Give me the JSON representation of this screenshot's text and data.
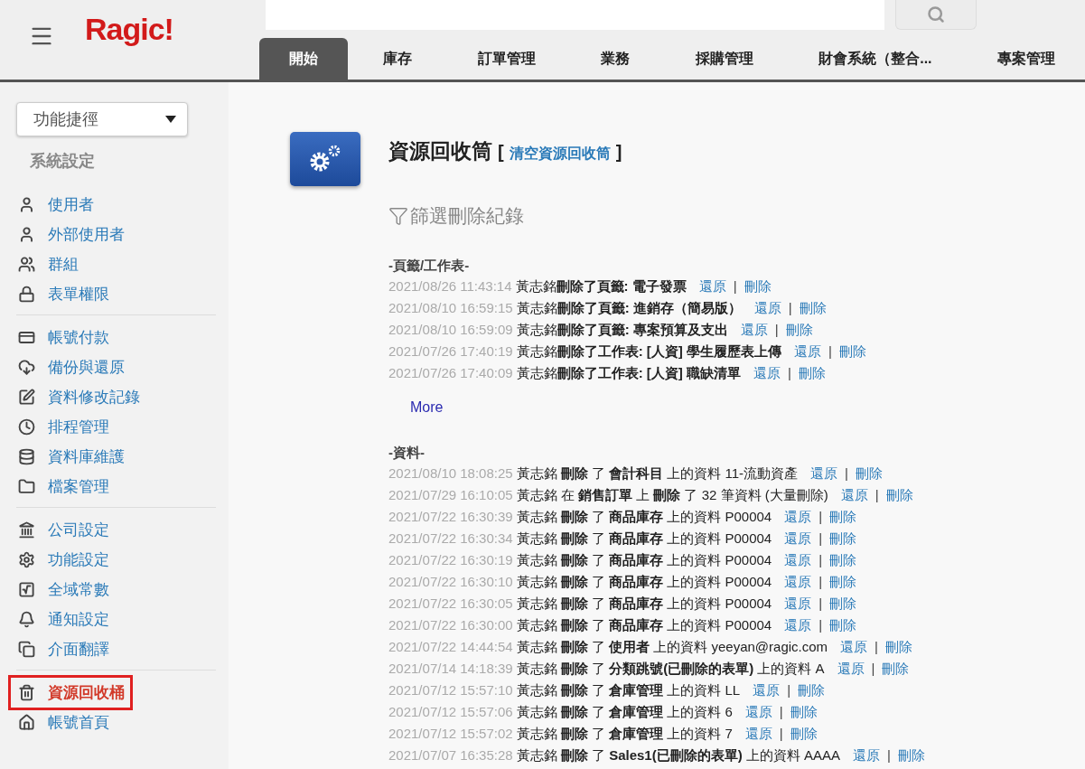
{
  "header": {
    "logo": "Ragic!",
    "tabs": [
      {
        "label": "開始",
        "selected": true
      },
      {
        "label": "庫存",
        "selected": false
      },
      {
        "label": "訂單管理",
        "selected": false
      },
      {
        "label": "業務",
        "selected": false
      },
      {
        "label": "採購管理",
        "selected": false
      },
      {
        "label": "財會系統（整合...",
        "selected": false
      },
      {
        "label": "專案管理",
        "selected": false
      }
    ]
  },
  "sidebar": {
    "shortcut": "功能捷徑",
    "section_title": "系統設定",
    "groups": [
      [
        {
          "kind": "user",
          "label": "使用者",
          "selected": false
        },
        {
          "kind": "user",
          "label": "外部使用者",
          "selected": false
        },
        {
          "kind": "group",
          "label": "群組",
          "selected": false
        },
        {
          "kind": "lock",
          "label": "表單權限",
          "selected": false
        }
      ],
      [
        {
          "kind": "card",
          "label": "帳號付款",
          "selected": false
        },
        {
          "kind": "cloud",
          "label": "備份與還原",
          "selected": false
        },
        {
          "kind": "edit",
          "label": "資料修改記錄",
          "selected": false
        },
        {
          "kind": "clock",
          "label": "排程管理",
          "selected": false
        },
        {
          "kind": "database",
          "label": "資料庫維護",
          "selected": false
        },
        {
          "kind": "folder",
          "label": "檔案管理",
          "selected": false
        }
      ],
      [
        {
          "kind": "bank",
          "label": "公司設定",
          "selected": false
        },
        {
          "kind": "gear",
          "label": "功能設定",
          "selected": false
        },
        {
          "kind": "sqrt",
          "label": "全域常數",
          "selected": false
        },
        {
          "kind": "bell",
          "label": "通知設定",
          "selected": false
        },
        {
          "kind": "copy",
          "label": "介面翻譯",
          "selected": false
        }
      ],
      [
        {
          "kind": "trash",
          "label": "資源回收桶",
          "selected": true
        },
        {
          "kind": "home",
          "label": "帳號首頁",
          "selected": false
        }
      ]
    ]
  },
  "main": {
    "separator": "|",
    "title": "資源回收筒",
    "empty_link": "清空資源回收筒",
    "bracket_open": "[",
    "bracket_close": "]",
    "filter": "篩選刪除紀錄",
    "sections": [
      {
        "title": "-頁籤/工作表-",
        "more": "More",
        "entries": [
          {
            "time": "2021/08/26 11:43:14",
            "text": "黃志銘**刪除了頁籤: 電子發票**",
            "restore": "還原",
            "delete": "刪除"
          },
          {
            "time": "2021/08/10 16:59:15",
            "text": "黃志銘**刪除了頁籤: 進銷存（簡易版）**",
            "restore": "還原",
            "delete": "刪除"
          },
          {
            "time": "2021/08/10 16:59:09",
            "text": "黃志銘**刪除了頁籤: 專案預算及支出**",
            "restore": "還原",
            "delete": "刪除"
          },
          {
            "time": "2021/07/26 17:40:19",
            "text": "黃志銘**刪除了工作表: [人資] 學生履歷表上傳**",
            "restore": "還原",
            "delete": "刪除"
          },
          {
            "time": "2021/07/26 17:40:09",
            "text": "黃志銘**刪除了工作表: [人資] 職缺清單**",
            "restore": "還原",
            "delete": "刪除"
          }
        ]
      },
      {
        "title": "-資料-",
        "entries": [
          {
            "time": "2021/08/10 18:08:25",
            "text": "黃志銘 **刪除** 了 **會計科目** 上的資料 11-流動資產",
            "restore": "還原",
            "delete": "刪除"
          },
          {
            "time": "2021/07/29 16:10:05",
            "text": "黃志銘 在 **銷售訂單** 上 **刪除** 了 32 筆資料 (大量刪除)",
            "restore": "還原",
            "delete": "刪除"
          },
          {
            "time": "2021/07/22 16:30:39",
            "text": "黃志銘 **刪除** 了 **商品庫存** 上的資料 P00004",
            "restore": "還原",
            "delete": "刪除"
          },
          {
            "time": "2021/07/22 16:30:34",
            "text": "黃志銘 **刪除** 了 **商品庫存** 上的資料 P00004",
            "restore": "還原",
            "delete": "刪除"
          },
          {
            "time": "2021/07/22 16:30:19",
            "text": "黃志銘 **刪除** 了 **商品庫存** 上的資料 P00004",
            "restore": "還原",
            "delete": "刪除"
          },
          {
            "time": "2021/07/22 16:30:10",
            "text": "黃志銘 **刪除** 了 **商品庫存** 上的資料 P00004",
            "restore": "還原",
            "delete": "刪除"
          },
          {
            "time": "2021/07/22 16:30:05",
            "text": "黃志銘 **刪除** 了 **商品庫存** 上的資料 P00004",
            "restore": "還原",
            "delete": "刪除"
          },
          {
            "time": "2021/07/22 16:30:00",
            "text": "黃志銘 **刪除** 了 **商品庫存** 上的資料 P00004",
            "restore": "還原",
            "delete": "刪除"
          },
          {
            "time": "2021/07/22 14:44:54",
            "text": "黃志銘 **刪除** 了 **使用者** 上的資料 yeeyan@ragic.com",
            "restore": "還原",
            "delete": "刪除"
          },
          {
            "time": "2021/07/14 14:18:39",
            "text": "黃志銘 **刪除** 了 **分類跳號(已刪除的表單)** 上的資料 A",
            "restore": "還原",
            "delete": "刪除"
          },
          {
            "time": "2021/07/12 15:57:10",
            "text": "黃志銘 **刪除** 了 **倉庫管理** 上的資料 LL",
            "restore": "還原",
            "delete": "刪除"
          },
          {
            "time": "2021/07/12 15:57:06",
            "text": "黃志銘 **刪除** 了 **倉庫管理** 上的資料 6",
            "restore": "還原",
            "delete": "刪除"
          },
          {
            "time": "2021/07/12 15:57:02",
            "text": "黃志銘 **刪除** 了 **倉庫管理** 上的資料 7",
            "restore": "還原",
            "delete": "刪除"
          },
          {
            "time": "2021/07/07 16:35:28",
            "text": "黃志銘 **刪除** 了 **Sales1(已刪除的表單)** 上的資料 AAAA",
            "restore": "還原",
            "delete": "刪除"
          }
        ]
      }
    ]
  }
}
